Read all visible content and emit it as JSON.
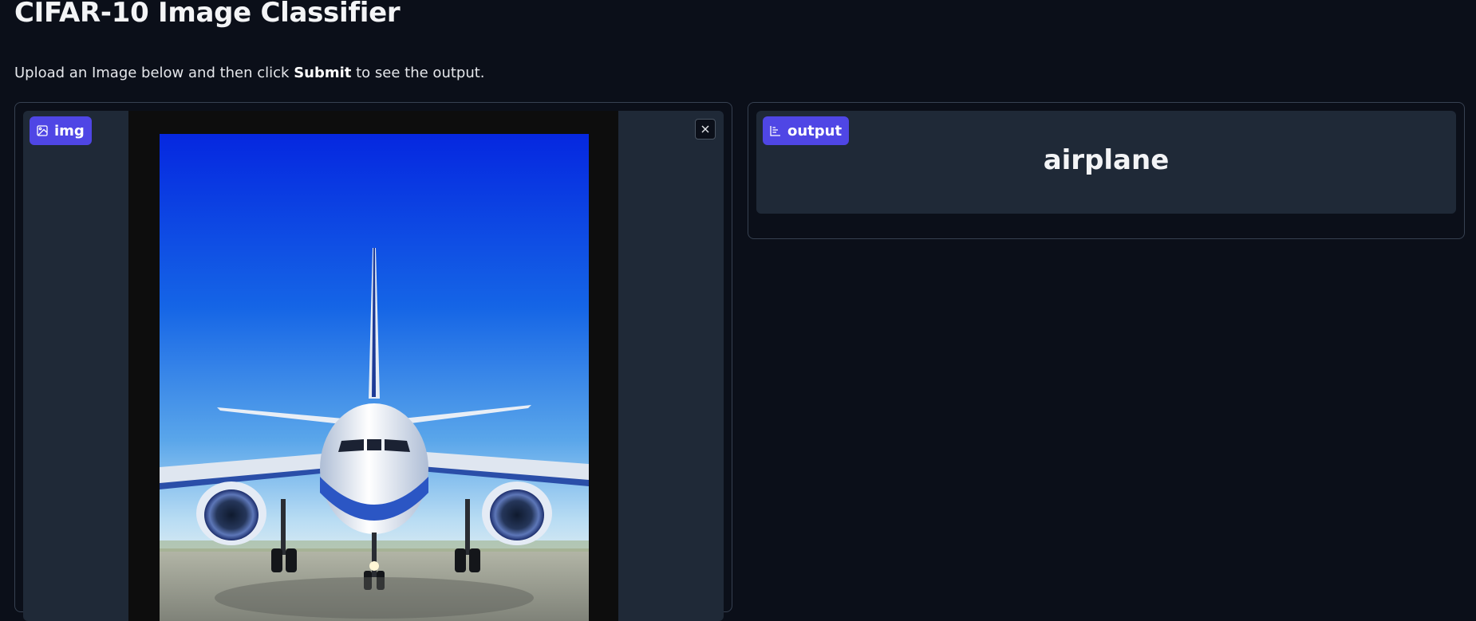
{
  "header": {
    "title": "CIFAR-10 Image Classifier",
    "description_prefix": "Upload an Image below and then click ",
    "description_bold": "Submit",
    "description_suffix": " to see the output."
  },
  "input_panel": {
    "label": "img",
    "label_icon": "image-icon",
    "close_icon": "close-icon",
    "image_subject": "airplane on runway"
  },
  "output_panel": {
    "label": "output",
    "label_icon": "bar-chart-icon",
    "value": "airplane"
  },
  "colors": {
    "background": "#0b0f19",
    "block": "#1f2937",
    "accent": "#4f46e5",
    "border": "#374151"
  }
}
